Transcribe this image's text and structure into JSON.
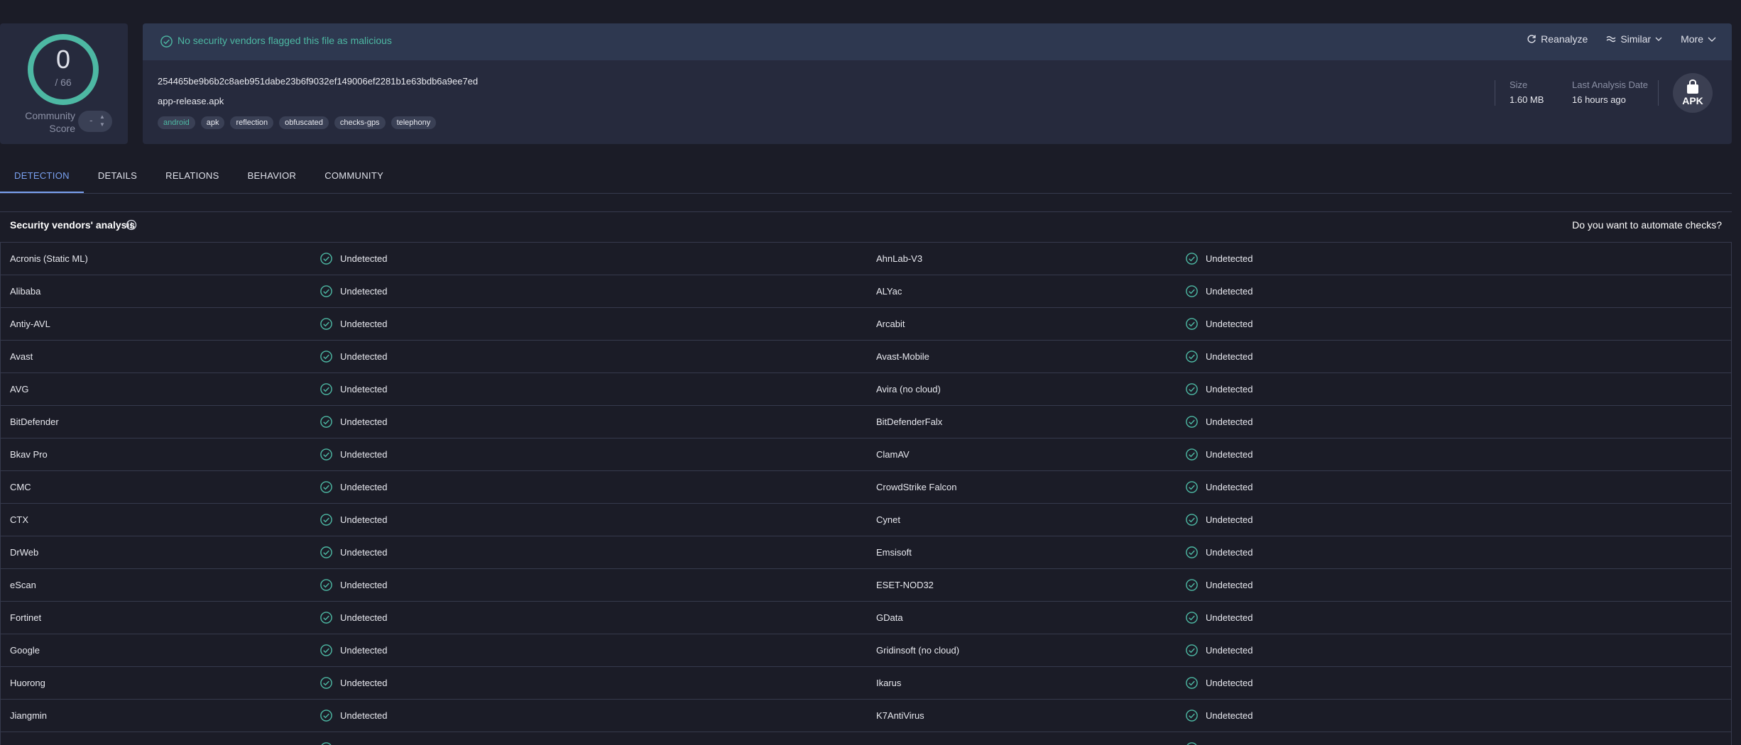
{
  "score": {
    "value": "0",
    "total": "/ 66",
    "community_label": "Community Score",
    "community_value": "-"
  },
  "banner": {
    "text": "No security vendors flagged this file as malicious"
  },
  "actions": {
    "reanalyze": "Reanalyze",
    "similar": "Similar",
    "more": "More"
  },
  "file": {
    "hash": "254465be9b6b2c8aeb951dabe23b6f9032ef149006ef2281b1e63bdb6a9ee7ed",
    "name": "app-release.apk",
    "tags": [
      "android",
      "apk",
      "reflection",
      "obfuscated",
      "checks-gps",
      "telephony"
    ]
  },
  "meta": {
    "size_label": "Size",
    "size_value": "1.60 MB",
    "date_label": "Last Analysis Date",
    "date_value": "16 hours ago",
    "file_type": "APK"
  },
  "tabs": [
    "DETECTION",
    "DETAILS",
    "RELATIONS",
    "BEHAVIOR",
    "COMMUNITY"
  ],
  "section": {
    "title": "Security vendors' analysis",
    "automate": "Do you want to automate checks?"
  },
  "colors": {
    "accent": "#7aa1f0",
    "ok": "#4db8a3",
    "background": "#1b1c27",
    "card": "#262a3d"
  },
  "vendors": [
    {
      "left": "Acronis (Static ML)",
      "left_status": "Undetected",
      "right": "AhnLab-V3",
      "right_status": "Undetected"
    },
    {
      "left": "Alibaba",
      "left_status": "Undetected",
      "right": "ALYac",
      "right_status": "Undetected"
    },
    {
      "left": "Antiy-AVL",
      "left_status": "Undetected",
      "right": "Arcabit",
      "right_status": "Undetected"
    },
    {
      "left": "Avast",
      "left_status": "Undetected",
      "right": "Avast-Mobile",
      "right_status": "Undetected"
    },
    {
      "left": "AVG",
      "left_status": "Undetected",
      "right": "Avira (no cloud)",
      "right_status": "Undetected"
    },
    {
      "left": "BitDefender",
      "left_status": "Undetected",
      "right": "BitDefenderFalx",
      "right_status": "Undetected"
    },
    {
      "left": "Bkav Pro",
      "left_status": "Undetected",
      "right": "ClamAV",
      "right_status": "Undetected"
    },
    {
      "left": "CMC",
      "left_status": "Undetected",
      "right": "CrowdStrike Falcon",
      "right_status": "Undetected"
    },
    {
      "left": "CTX",
      "left_status": "Undetected",
      "right": "Cynet",
      "right_status": "Undetected"
    },
    {
      "left": "DrWeb",
      "left_status": "Undetected",
      "right": "Emsisoft",
      "right_status": "Undetected"
    },
    {
      "left": "eScan",
      "left_status": "Undetected",
      "right": "ESET-NOD32",
      "right_status": "Undetected"
    },
    {
      "left": "Fortinet",
      "left_status": "Undetected",
      "right": "GData",
      "right_status": "Undetected"
    },
    {
      "left": "Google",
      "left_status": "Undetected",
      "right": "Gridinsoft (no cloud)",
      "right_status": "Undetected"
    },
    {
      "left": "Huorong",
      "left_status": "Undetected",
      "right": "Ikarus",
      "right_status": "Undetected"
    },
    {
      "left": "Jiangmin",
      "left_status": "Undetected",
      "right": "K7AntiVirus",
      "right_status": "Undetected"
    },
    {
      "left": "",
      "left_status": "",
      "right": "",
      "right_status": ""
    }
  ]
}
